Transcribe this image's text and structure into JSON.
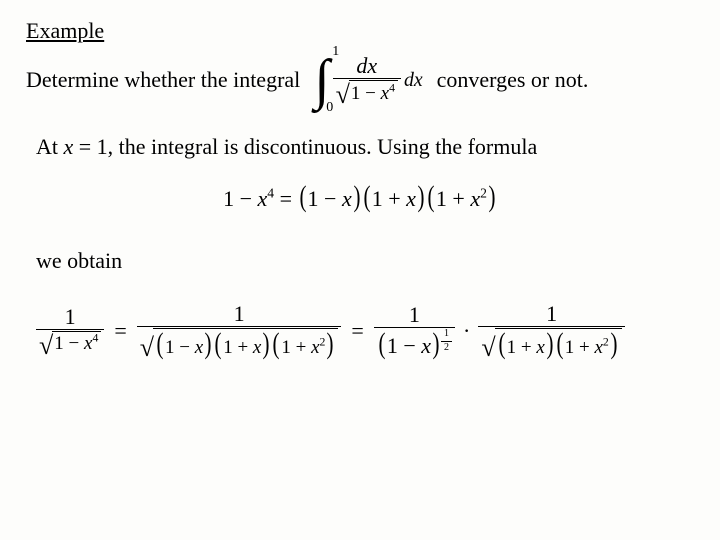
{
  "heading": "Example",
  "line1_pre": "Determine whether the integral",
  "line1_post": "converges or not.",
  "integral": {
    "upper": "1",
    "lower": "0",
    "num": "dx",
    "rad_a": "1 − ",
    "rad_var": "x",
    "rad_exp": "4",
    "trail": "dx"
  },
  "line2_a": "At ",
  "line2_var": "x",
  "line2_b": " = 1, the integral is discontinuous. Using the formula",
  "factor": {
    "lhs_a": "1 − ",
    "lhs_var": "x",
    "lhs_exp": "4",
    "eq": " = ",
    "p1_a": "1 − ",
    "p1_v": "x",
    "p2_a": "1 + ",
    "p2_v": "x",
    "p3_a": "1 + ",
    "p3_v": "x",
    "p3_exp": "2"
  },
  "line3": "we obtain",
  "chain": {
    "lhs_num": "1",
    "lhs_rad_a": "1 − ",
    "lhs_rad_v": "x",
    "lhs_rad_e": "4",
    "mid_num": "1",
    "mid_p1_a": "1 − ",
    "mid_p1_v": "x",
    "mid_p2_a": "1 + ",
    "mid_p2_v": "x",
    "mid_p3_a": "1 + ",
    "mid_p3_v": "x",
    "mid_p3_e": "2",
    "r1_num": "1",
    "r1_base_a": "1 − ",
    "r1_base_v": "x",
    "r1_exp_top": "1",
    "r1_exp_bot": "2",
    "r2_num": "1",
    "r2_p2_a": "1 + ",
    "r2_p2_v": "x",
    "r2_p3_a": "1 + ",
    "r2_p3_v": "x",
    "r2_p3_e": "2",
    "eq": "="
  }
}
